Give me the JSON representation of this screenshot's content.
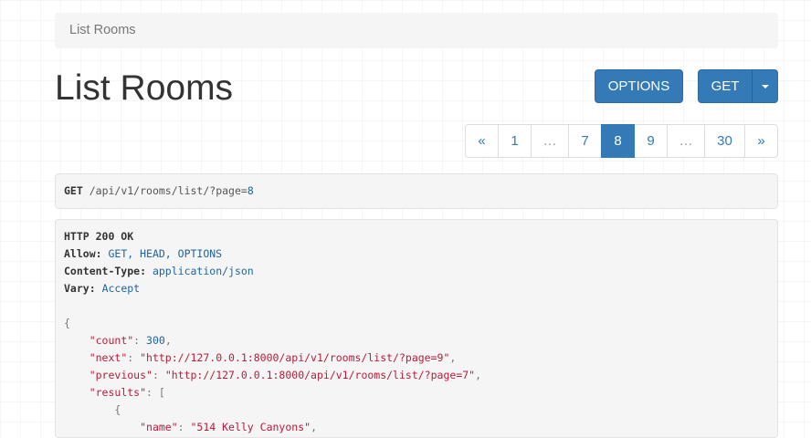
{
  "breadcrumb": {
    "label": "List Rooms"
  },
  "page": {
    "title": "List Rooms"
  },
  "toolbar": {
    "options_label": "OPTIONS",
    "get_label": "GET"
  },
  "pagination": {
    "prev": "«",
    "items": [
      "1",
      "…",
      "7",
      "8",
      "9",
      "…",
      "30"
    ],
    "active": "8",
    "next": "»"
  },
  "request": {
    "method": "GET",
    "path": "/api/v1/rooms/list/?page=",
    "page": "8"
  },
  "response": {
    "status": "HTTP 200 OK",
    "headers": [
      {
        "key": "Allow:",
        "value": "GET, HEAD, OPTIONS"
      },
      {
        "key": "Content-Type:",
        "value": "application/json"
      },
      {
        "key": "Vary:",
        "value": "Accept"
      }
    ],
    "body": {
      "open_brace": "{",
      "count_key": "\"count\"",
      "count_val": "300",
      "next_key": "\"next\"",
      "next_val": "\"http://127.0.0.1:8000/api/v1/rooms/list/?page=9\"",
      "previous_key": "\"previous\"",
      "previous_val": "\"http://127.0.0.1:8000/api/v1/rooms/list/?page=7\"",
      "results_key": "\"results\"",
      "results_open": "[",
      "item_open": "{",
      "name_key": "\"name\"",
      "name_val": "\"514 Kelly Canyons\""
    }
  },
  "colors": {
    "primary": "#337ab7",
    "json_key": "#b81c3a",
    "json_value": "#1e64a0"
  }
}
